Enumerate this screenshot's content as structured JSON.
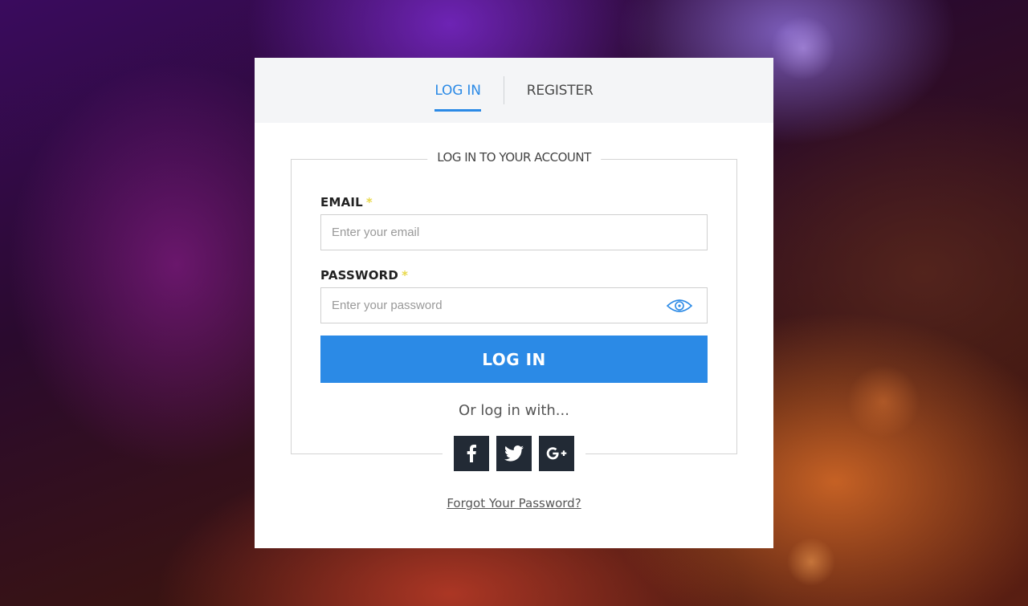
{
  "tabs": [
    {
      "label": "LOG IN",
      "active": true
    },
    {
      "label": "REGISTER",
      "active": false
    }
  ],
  "form": {
    "legend": "LOG IN TO YOUR ACCOUNT",
    "email": {
      "label": "EMAIL",
      "required_mark": "*",
      "placeholder": "Enter your email",
      "value": ""
    },
    "password": {
      "label": "PASSWORD",
      "required_mark": "*",
      "placeholder": "Enter your password",
      "value": ""
    },
    "submit_label": "LOG IN",
    "social_prompt": "Or log in with...",
    "social": [
      {
        "icon": "facebook-icon"
      },
      {
        "icon": "twitter-icon"
      },
      {
        "icon": "google-plus-icon"
      }
    ],
    "forgot_link": "Forgot Your Password?"
  },
  "colors": {
    "accent": "#2b8ae6",
    "required": "#e8d84a",
    "social_bg": "#222a35",
    "tab_bar_bg": "#f4f5f7"
  }
}
